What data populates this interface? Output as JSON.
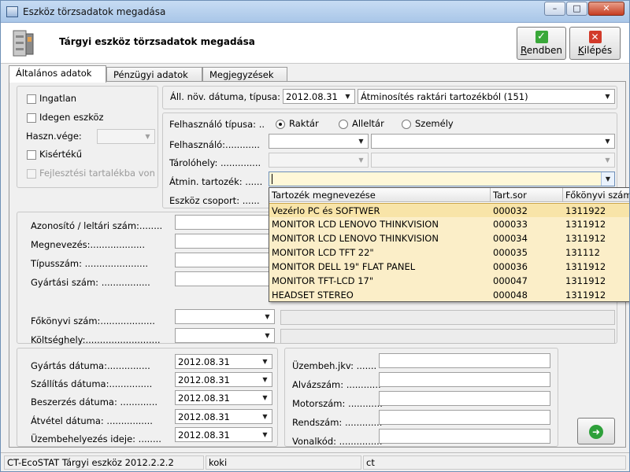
{
  "window": {
    "title": "Eszköz törzsadatok megadása"
  },
  "header": {
    "title": "Tárgyi eszköz törzsadatok megadása",
    "ok_label": "Rendben",
    "ok_key": "R",
    "exit_label": "Kilépés",
    "exit_key": "K"
  },
  "tabs": [
    {
      "label": "Általános adatok"
    },
    {
      "label": "Pénzügyi adatok"
    },
    {
      "label": "Megjegyzések"
    }
  ],
  "left_options": {
    "ingatlan": "Ingatlan",
    "idegen": "Idegen eszköz",
    "hasznvege": "Haszn.vége:",
    "kiserteku": "Kisértékű",
    "fejlesztesi": "Fejlesztési tartalékba von"
  },
  "top": {
    "all_nov_label": "Áll. növ. dátuma, típusa:",
    "all_nov_date": "2012.08.31",
    "all_nov_type": "Átminosítés raktári tartozékból (151)"
  },
  "user": {
    "type_label": "Felhasználó típusa: ..",
    "radio_raktar": "Raktár",
    "radio_alleltar": "Alleltár",
    "radio_szemely": "Személy",
    "user_label": "Felhasználó:............",
    "storage_label": "Tárolóhely: ..............",
    "atmin_label": "Átmin. tartozék: ......",
    "group_label": "Eszköz csoport: ......"
  },
  "dropdown": {
    "headers": [
      "Tartozék megnevezése",
      "Tart.sor",
      "Főkönyvi szám"
    ],
    "rows": [
      {
        "name": "Vezérlo PC és SOFTWER",
        "tart": "000032",
        "fokonyv": "1311922"
      },
      {
        "name": "MONITOR LCD LENOVO THINKVISION",
        "tart": "000033",
        "fokonyv": "1311912"
      },
      {
        "name": "MONITOR LCD LENOVO THINKVISION",
        "tart": "000034",
        "fokonyv": "1311912"
      },
      {
        "name": "MONITOR LCD TFT 22\"",
        "tart": "000035",
        "fokonyv": "131112"
      },
      {
        "name": "MONITOR DELL 19\" FLAT PANEL",
        "tart": "000036",
        "fokonyv": "1311912"
      },
      {
        "name": "MONITOR TFT-LCD 17\"",
        "tart": "000047",
        "fokonyv": "1311912"
      },
      {
        "name": "HEADSET STEREO",
        "tart": "000048",
        "fokonyv": "1311912"
      }
    ]
  },
  "ident": {
    "azonosito": "Azonosító / leltári szám:........",
    "megnevezes": "Megnevezés:...................",
    "tipusszam": "Típusszám: ......................",
    "gyartasi": "Gyártási szám: .................",
    "fokonyvi": "Főkönyvi szám:...................",
    "koltseghely": "Költséghely:.........................."
  },
  "dates": {
    "gyartas_label": "Gyártás dátuma:...............",
    "gyartas": "2012.08.31",
    "szallitas_label": "Szállítás dátuma:...............",
    "szallitas": "2012.08.31",
    "beszerzes_label": "Beszerzés dátuma: .............",
    "beszerzes": "2012.08.31",
    "atvetel_label": "Átvétel dátuma: ................",
    "atvetel": "2012.08.31",
    "uzembe_label": "Üzembehelyezés ideje: ........",
    "uzembe": "2012.08.31"
  },
  "extra": {
    "uzembeh": "Üzembeh.jkv: .......",
    "alvazszam": "Alvázszám: ............",
    "motorszam": "Motorszám: ............",
    "rendszam": "Rendszám: .............",
    "vonalkod": "Vonalkód: ..............."
  },
  "status": {
    "app": "CT-EcoSTAT Tárgyi eszköz 2012.2.2.2",
    "user": "koki",
    "db": "ct"
  },
  "icons": {
    "window": "app-window-icon",
    "header": "cabinet-icon",
    "ok": "check-icon",
    "exit": "x-icon",
    "go": "arrow-right-icon"
  }
}
